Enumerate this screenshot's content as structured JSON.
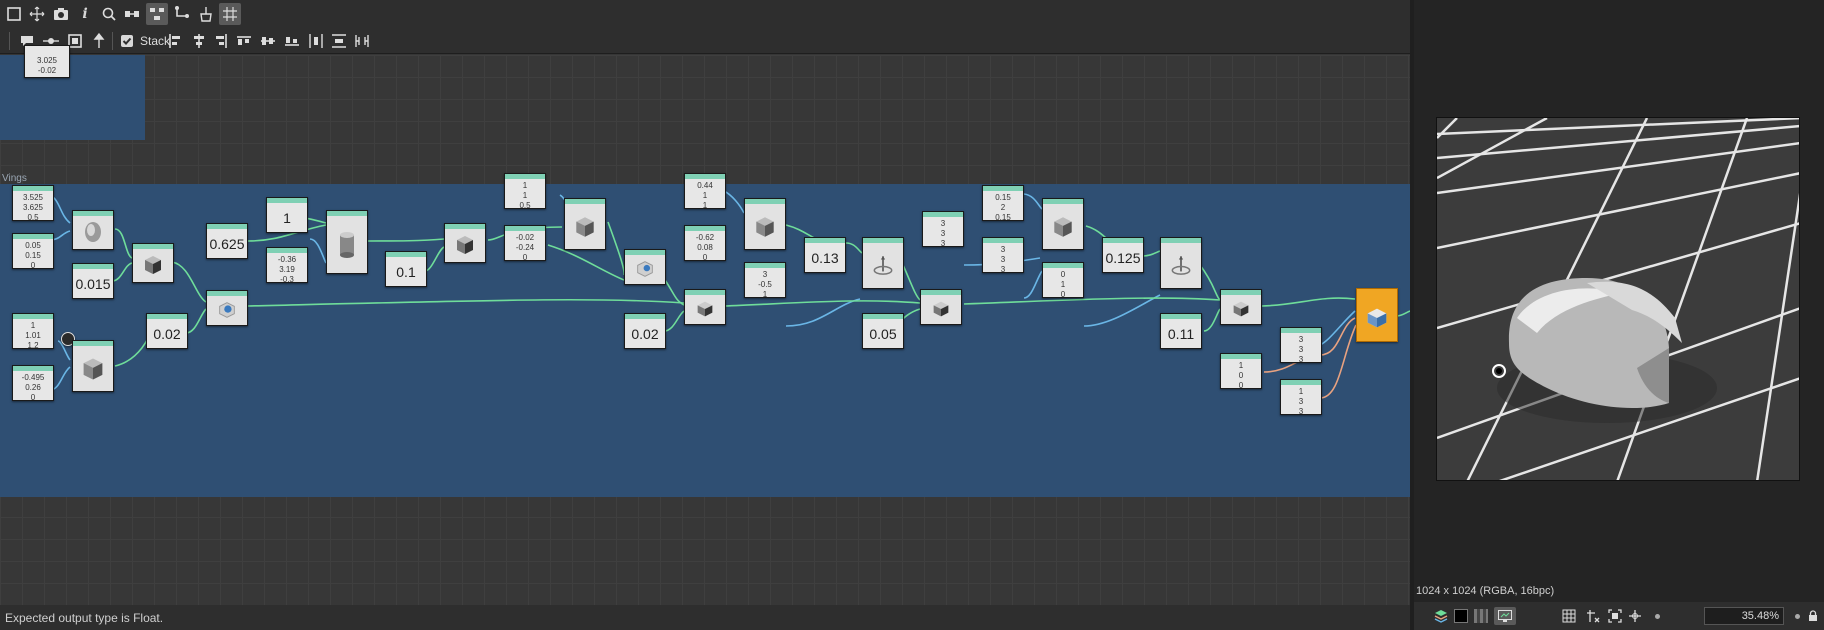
{
  "toolbar": {
    "stack_label": "Stack",
    "stack_checked": true,
    "icons": [
      "frame-icon",
      "move-icon",
      "camera-icon",
      "info-icon",
      "search-icon",
      "link-icon",
      "graph-layout-icon",
      "connect-icon",
      "clean-icon",
      "grid-snap-icon"
    ]
  },
  "frames": {
    "wings_label": "Vings"
  },
  "nodes": {
    "top_value": [
      "3.025",
      "-0.02"
    ],
    "v1": [
      "3.525",
      "3.625",
      "0.5"
    ],
    "v2": [
      "0.05",
      "0.15",
      "0"
    ],
    "v3": "0.015",
    "v4": [
      "1",
      "1.01",
      "1.2"
    ],
    "v5": [
      "-0.495",
      "0.26",
      "0"
    ],
    "v6": "0.625",
    "v7": "1",
    "v8": [
      "-0.36",
      "3.19",
      "-0.3"
    ],
    "v9": "0.02",
    "v10": "0.1",
    "v11": [
      "1",
      "1",
      "0.5"
    ],
    "v12": [
      "-0.02",
      "-0.24",
      "0"
    ],
    "v13": "0.02",
    "v14": [
      "0.44",
      "1",
      "1"
    ],
    "v15": [
      "-0.62",
      "0.08",
      "0"
    ],
    "v16": [
      "3",
      "-0.5",
      "1"
    ],
    "v17": "0.13",
    "v18": "0.05",
    "v19": [
      "3",
      "3",
      "3"
    ],
    "v20": [
      "0.15",
      "2",
      "0.15"
    ],
    "v21": [
      "3",
      "3",
      "3"
    ],
    "v22": [
      "0",
      "1",
      "0"
    ],
    "v23": "0.125",
    "v24": "0.11",
    "v25": [
      "3",
      "3",
      "3"
    ],
    "v26": [
      "1",
      "0",
      "0"
    ],
    "v27": [
      "1",
      "3",
      "3"
    ]
  },
  "status": {
    "message": "Expected output type is Float."
  },
  "viewer": {
    "info": "1024 x 1024 (RGBA, 16bpc)",
    "zoom": "35.48%"
  },
  "colors": {
    "frame": "#2f4f73",
    "wire_green": "#6fdd9a",
    "wire_blue": "#6ab6e6",
    "wire_orange": "#e8a280",
    "output_node": "#f0a623",
    "node_header": "#7fd0b4"
  }
}
